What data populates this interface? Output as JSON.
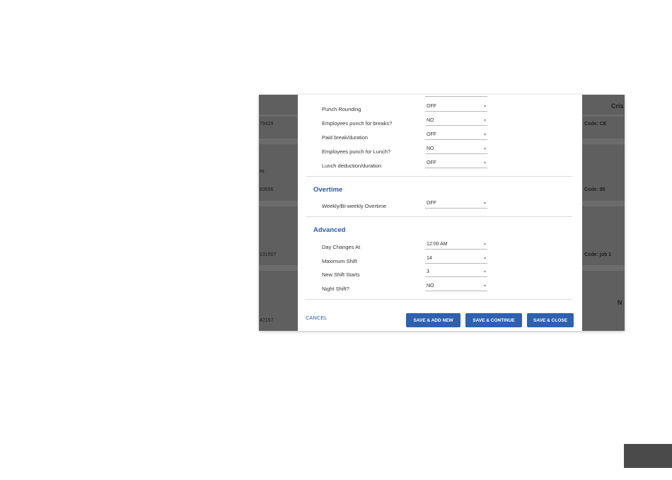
{
  "background": {
    "left_rows": [
      {
        "text": "79429"
      },
      {
        "text": "rs"
      },
      {
        "text": "83696"
      },
      {
        "text": "131507"
      },
      {
        "text": "42157"
      }
    ],
    "right_rows": [
      {
        "text": "Cris"
      },
      {
        "text": "Code: CE"
      },
      {
        "text": "Code: 95"
      },
      {
        "text": "Code: job 1"
      },
      {
        "text": "N"
      }
    ]
  },
  "modal": {
    "partial_top_row": {
      "label": "",
      "value": ""
    },
    "break_settings": [
      {
        "label": "Punch Rounding",
        "value": "OFF"
      },
      {
        "label": "Employees punch for breaks?",
        "value": "NO"
      },
      {
        "label": "Paid break/duration",
        "value": "OFF"
      },
      {
        "label": "Employees punch for Lunch?",
        "value": "NO"
      },
      {
        "label": "Lunch deduction/duration",
        "value": "OFF"
      }
    ],
    "overtime": {
      "title": "Overtime",
      "rows": [
        {
          "label": "Weekly/Bi-weekly Overtime",
          "value": "OFF"
        }
      ]
    },
    "advanced": {
      "title": "Advanced",
      "rows": [
        {
          "label": "Day Changes At",
          "value": "12:00 AM"
        },
        {
          "label": "Maximum Shift",
          "value": "14"
        },
        {
          "label": "New Shift Starts",
          "value": "3"
        },
        {
          "label": "Night Shift?",
          "value": "NO"
        }
      ]
    },
    "footer": {
      "cancel": "CANCEL",
      "save_add_new": "SAVE & ADD NEW",
      "save_continue": "SAVE & CONTINUE",
      "save_close": "SAVE & CLOSE"
    }
  },
  "colors": {
    "accent": "#2f61b0",
    "section_title": "#2b5aa8",
    "overlay": "#5f5f5f"
  },
  "icons": {
    "dropdown": "chevron-down-icon"
  }
}
